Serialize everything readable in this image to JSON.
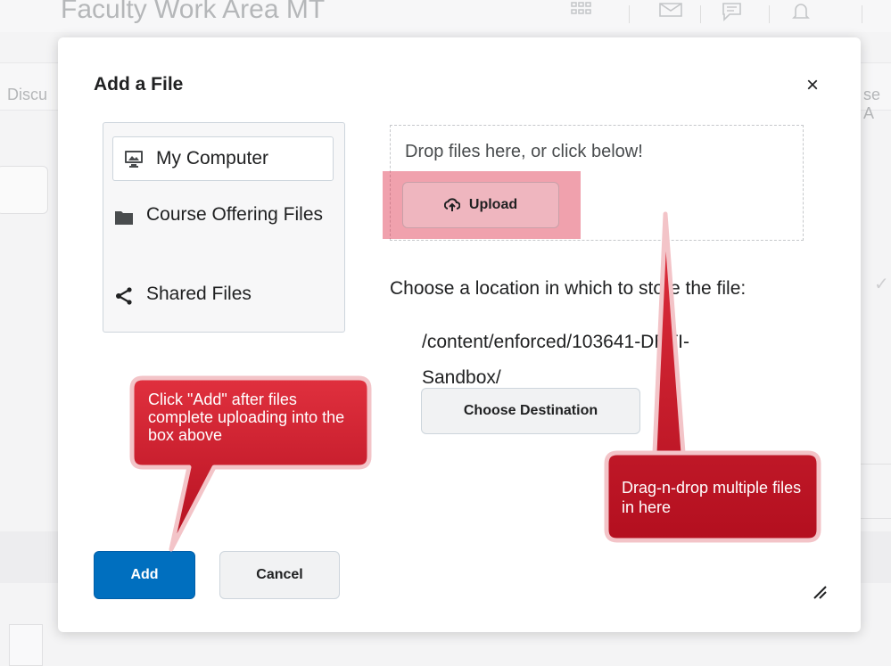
{
  "background": {
    "page_title": "Faculty Work Area MT",
    "nav_left_fragment": "Discu",
    "nav_right_fragment": "se A"
  },
  "dialog": {
    "title": "Add a File",
    "close_label": "×",
    "sources": [
      {
        "label": "My Computer",
        "icon": "monitor-icon",
        "selected": true
      },
      {
        "label": "Course Offering Files",
        "icon": "folder-icon",
        "selected": false
      },
      {
        "label": "Shared Files",
        "icon": "share-icon",
        "selected": false
      }
    ],
    "dropzone_text": "Drop files here, or click below!",
    "upload_label": "Upload",
    "location_label": "Choose a location in which to store the file:",
    "location_path": "/content/enforced/103641-DETI-Sandbox/",
    "choose_destination_label": "Choose Destination",
    "add_label": "Add",
    "cancel_label": "Cancel"
  },
  "annotations": {
    "callout_add": "Click \"Add\" after files complete uploading into the box above",
    "callout_drop": "Drag-n-drop multiple files in here"
  },
  "colors": {
    "primary": "#006fbf",
    "annotation_red": "#cc1a2a",
    "highlight": "#e8798a"
  }
}
